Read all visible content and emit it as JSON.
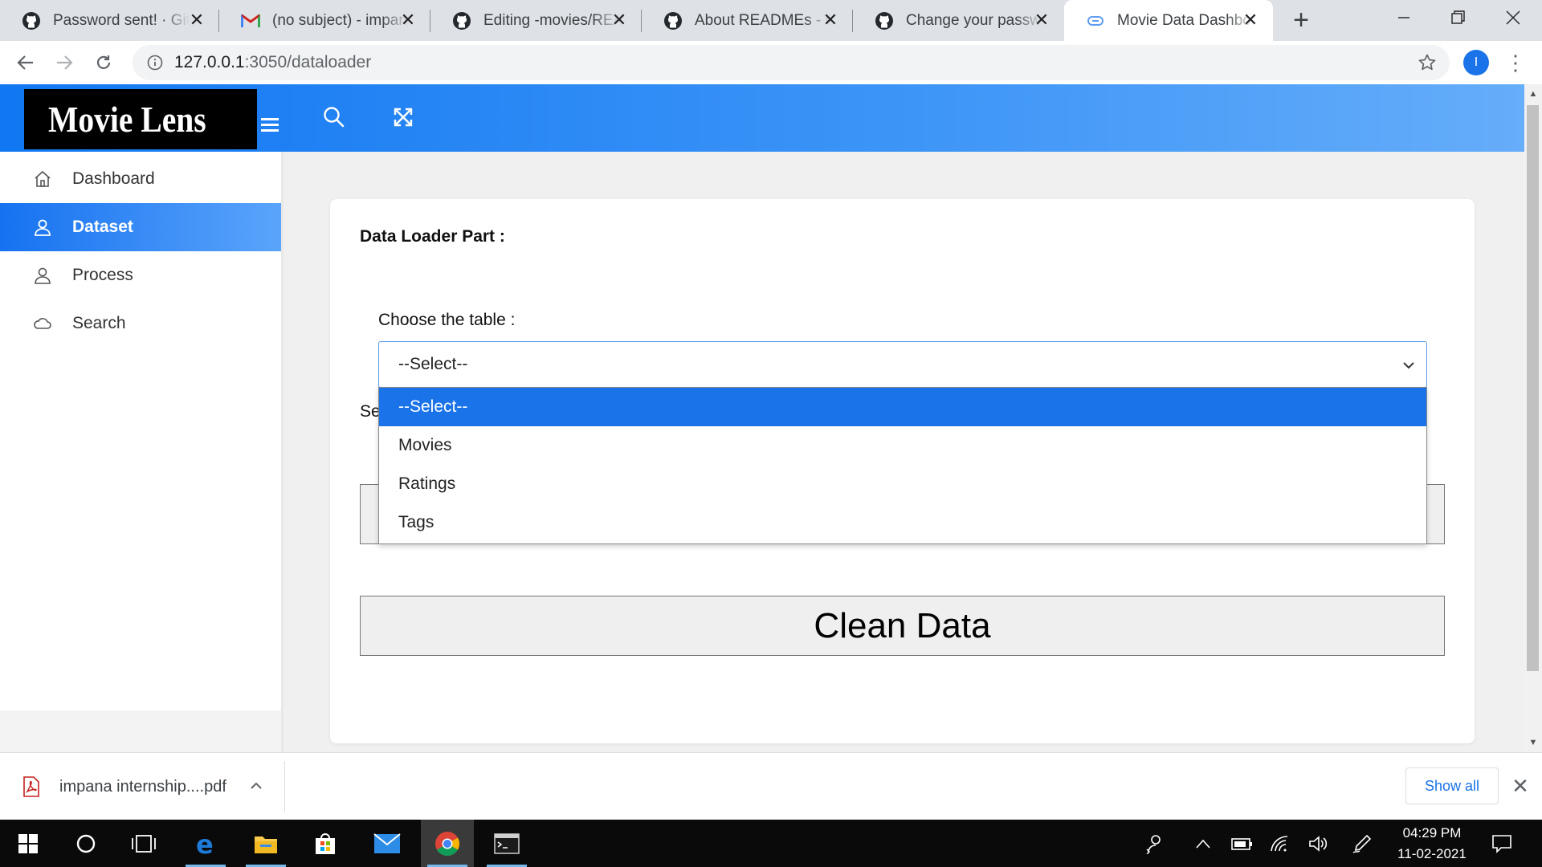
{
  "browser": {
    "tabs": [
      {
        "title": "Password sent! · GitHub",
        "icon": "github-icon",
        "active": false
      },
      {
        "title": "(no subject) - impana",
        "icon": "gmail-icon",
        "active": false
      },
      {
        "title": "Editing -movies/README",
        "icon": "github-icon",
        "active": false
      },
      {
        "title": "About READMEs - GitHub",
        "icon": "github-icon",
        "active": false
      },
      {
        "title": "Change your password",
        "icon": "github-icon",
        "active": false
      },
      {
        "title": "Movie Data Dashboard",
        "icon": "globe-icon",
        "active": true
      }
    ],
    "url_host": "127.0.0.1",
    "url_path": ":3050/dataloader",
    "profile_initial": "I"
  },
  "app": {
    "brand": "Movie Lens",
    "sidebar": [
      {
        "label": "Dashboard",
        "icon": "home-icon",
        "active": false
      },
      {
        "label": "Dataset",
        "icon": "user-icon",
        "active": true
      },
      {
        "label": "Process",
        "icon": "user-icon",
        "active": false
      },
      {
        "label": "Search",
        "icon": "cloud-icon",
        "active": false
      }
    ],
    "card": {
      "title": "Data Loader Part :",
      "choose_label": "Choose the table :",
      "select_value": "--Select--",
      "options": [
        "--Select--",
        "Movies",
        "Ratings",
        "Tags"
      ],
      "partial_label": "Se",
      "clean_button": "Clean Data"
    }
  },
  "downloads": {
    "file": "impana internship....pdf",
    "show_all": "Show all"
  },
  "taskbar": {
    "time": "04:29 PM",
    "date": "11-02-2021"
  },
  "colors": {
    "accent": "#1a73e8",
    "topbar_start": "#1177f2",
    "topbar_end": "#66adfa"
  }
}
